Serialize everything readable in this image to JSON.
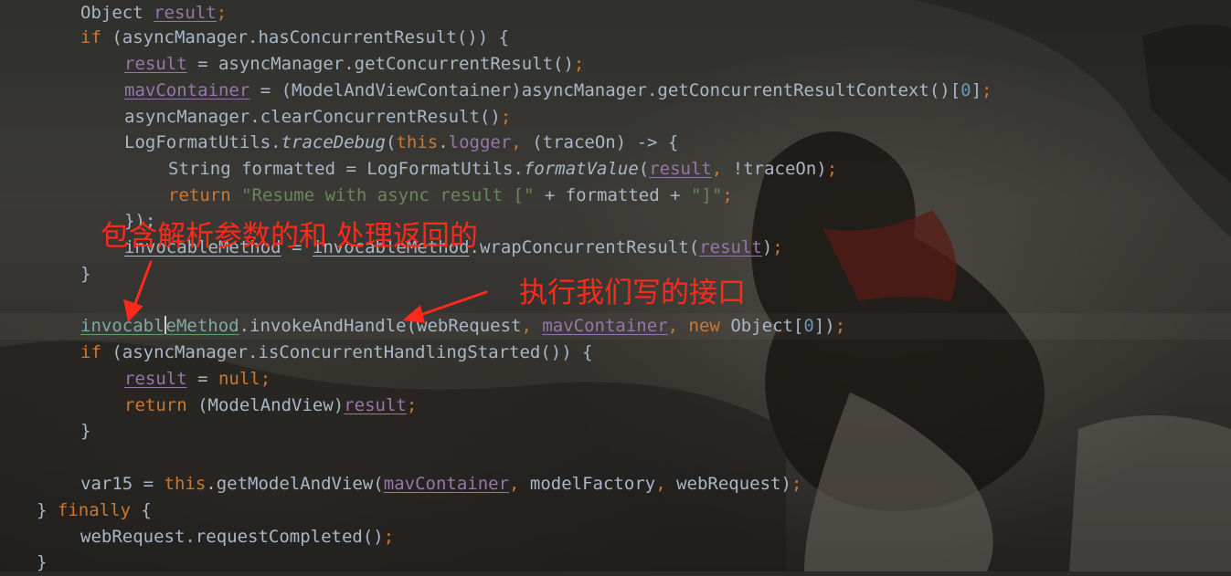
{
  "code": {
    "l1_a": "Object ",
    "l1_b": "result",
    "l1_c": ";",
    "l2_kw": "if",
    "l2_rest": " (asyncManager.hasConcurrentResult()) {",
    "l3_var": "result",
    "l3_rest": " = asyncManager.getConcurrentResult()",
    "l3_semi": ";",
    "l4_var": "mavContainer",
    "l4_rest": " = (ModelAndViewContainer)asyncManager.getConcurrentResultContext()[",
    "l4_num": "0",
    "l4_end": "]",
    "l4_semi": ";",
    "l5_rest": "asyncManager.clearConcurrentResult()",
    "l5_semi": ";",
    "l6_a": "LogFormatUtils.",
    "l6_method": "traceDebug",
    "l6_b": "(",
    "l6_this": "this",
    "l6_dot": ".",
    "l6_logger": "logger",
    "l6_comma": ",",
    "l6_c": " (traceOn) -> {",
    "l7_a": "String formatted = LogFormatUtils.",
    "l7_method": "formatValue",
    "l7_b": "(",
    "l7_var": "result",
    "l7_comma": ",",
    "l7_c": " !traceOn)",
    "l7_semi": ";",
    "l8_kw": "return",
    "l8_str1": "\"Resume with async result [\"",
    "l8_mid": " + formatted + ",
    "l8_str2": "\"]\"",
    "l8_semi": ";",
    "l9": "});",
    "l10_a": "invocableMethod",
    "l10_b": " = ",
    "l10_c": "invocableMethod",
    "l10_d": ".wrapConcurrentResult(",
    "l10_var": "result",
    "l10_e": ")",
    "l10_semi": ";",
    "l11": "}",
    "l13_a1": "invocabl",
    "l13_a2": "eMethod",
    "l13_b": ".invokeAndHandle(webRequest",
    "l13_comma1": ",",
    "l13_sp": " ",
    "l13_var": "mavContainer",
    "l13_comma2": ",",
    "l13_new": "new",
    "l13_c": " Object[",
    "l13_num": "0",
    "l13_d": "])",
    "l13_semi": ";",
    "l14_kw": "if",
    "l14_rest": " (asyncManager.isConcurrentHandlingStarted()) {",
    "l15_var": "result",
    "l15_eq": " = ",
    "l15_null": "null",
    "l15_semi": ";",
    "l16_kw": "return",
    "l16_a": " (ModelAndView)",
    "l16_var": "result",
    "l16_semi": ";",
    "l17": "}",
    "l19_a": "var15 = ",
    "l19_this": "this",
    "l19_b": ".getModelAndView(",
    "l19_var": "mavContainer",
    "l19_comma1": ",",
    "l19_c": " modelFactory",
    "l19_comma2": ",",
    "l19_d": " webRequest)",
    "l19_semi": ";",
    "l20_a": "} ",
    "l20_kw": "finally",
    "l20_b": " {",
    "l21_a": "webRequest.requestCompleted()",
    "l21_semi": ";",
    "l22": "}"
  },
  "annotations": {
    "note1": "包含解析参数的和 处理返回的",
    "note2": "执行我们写的接口",
    "color": "#ff2a1a"
  }
}
